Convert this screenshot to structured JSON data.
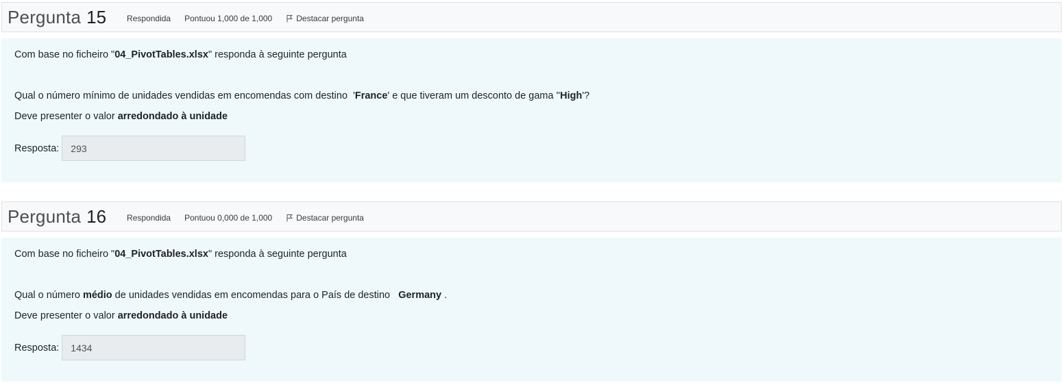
{
  "questions": [
    {
      "title": "Pergunta",
      "number": "15",
      "status": "Respondida",
      "score": "Pontuou 1,000 de 1,000",
      "flag_label": "Destacar pergunta",
      "intro_pre": "Com base no ficheiro \"",
      "intro_file": "04_PivotTables.xlsx",
      "intro_post": "\" responda à seguinte pergunta",
      "q_text_1": "Qual o número mínimo de unidades vendidas em encomendas com destino  '",
      "q_bold_1": "France",
      "q_text_2": "' e que tiveram um desconto de gama ''",
      "q_bold_2": "High",
      "q_text_3": "'?",
      "round_pre": "Deve presenter o valor ",
      "round_bold": "arredondado à unidade",
      "answer_label": "Resposta:",
      "answer_value": "293"
    },
    {
      "title": "Pergunta",
      "number": "16",
      "status": "Respondida",
      "score": "Pontuou 0,000 de 1,000",
      "flag_label": "Destacar pergunta",
      "intro_pre": "Com base no ficheiro \"",
      "intro_file": "04_PivotTables.xlsx",
      "intro_post": "\" responda à seguinte pergunta",
      "q_text_1": "Qual o número ",
      "q_bold_1": "médio",
      "q_text_2": " de unidades vendidas em encomendas para o País de destino   ",
      "q_bold_2": "Germany",
      "q_text_3": " .",
      "round_pre": "Deve presenter o valor ",
      "round_bold": "arredondado à unidade",
      "answer_label": "Resposta:",
      "answer_value": "1434"
    }
  ],
  "icons": {
    "flag": "flag-icon"
  }
}
